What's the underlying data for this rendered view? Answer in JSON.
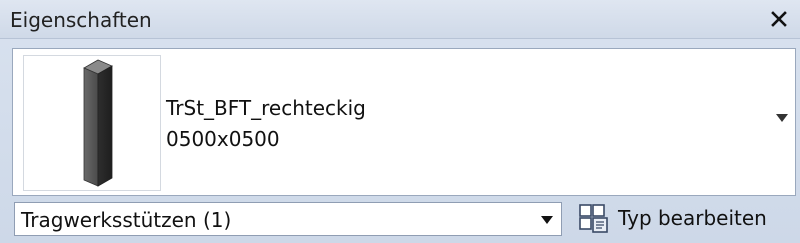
{
  "panel": {
    "title": "Eigenschaften",
    "close_icon": "close-icon"
  },
  "type_selector": {
    "family": "TrSt_BFT_rechteckig",
    "type": "0500x0500",
    "preview_icon": "column-preview-icon",
    "dropdown_icon": "chevron-down-icon"
  },
  "instance_filter": {
    "selected": "Tragwerksstützen (1)",
    "dropdown_icon": "chevron-down-icon"
  },
  "edit_type": {
    "label": "Typ bearbeiten",
    "icon": "edit-type-icon"
  },
  "colors": {
    "panel_bg": "#cfd9e8",
    "field_bg": "#ffffff",
    "border": "#9aa8bd"
  }
}
